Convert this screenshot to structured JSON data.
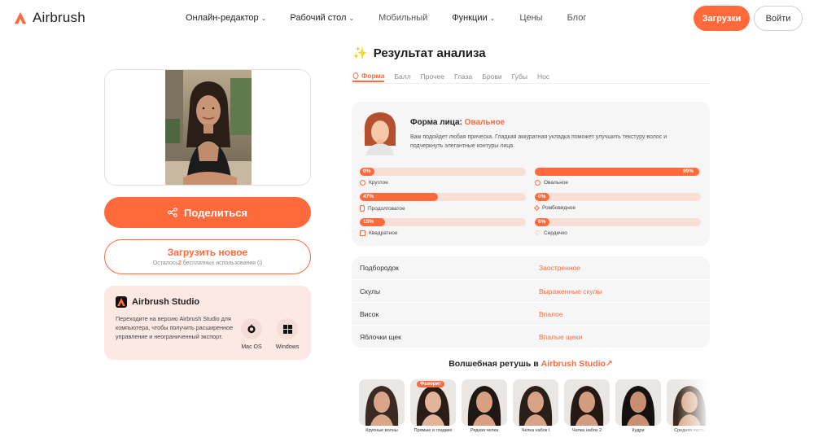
{
  "brand": {
    "name": "Airbrush",
    "accent": "#ff6a3d"
  },
  "nav": {
    "items": [
      {
        "label": "Онлайн-редактор",
        "dropdown": true
      },
      {
        "label": "Рабочий стол",
        "dropdown": true
      },
      {
        "label": "Мобильный",
        "dropdown": false
      },
      {
        "label": "Функции",
        "dropdown": true
      },
      {
        "label": "Цены",
        "dropdown": false
      },
      {
        "label": "Блог",
        "dropdown": false
      }
    ],
    "upload_label": "Загрузки",
    "login_label": "Войти"
  },
  "left": {
    "share_label": "Поделиться",
    "upload_new_label": "Загрузить новое",
    "remaining_prefix": "Осталось",
    "remaining_count": "2",
    "remaining_suffix": " бесплатных использования",
    "studio": {
      "title": "Airbrush Studio",
      "description": "Переходите на версию Airbrush Studio для компьютера, чтобы получить расширенное управление и неограниченный экспорт.",
      "os": [
        {
          "label": "Mac OS",
          "icon": "apple-icon"
        },
        {
          "label": "Windows",
          "icon": "windows-icon"
        }
      ]
    }
  },
  "result": {
    "title": "Результат анализа",
    "tabs": [
      "Форма",
      "Балл",
      "Прочее",
      "Глаза",
      "Брови",
      "Губы",
      "Нос"
    ],
    "active_tab": "Форма",
    "face_shape_label": "Форма лица:",
    "face_shape_value": "Овальное",
    "face_shape_desc": "Вам подойдет любая прическа. Гладкая аккуратная укладка поможет улучшить текстуру волос и подчеркнуть элегантные контуры лица.",
    "shapes": [
      {
        "name": "Круглое",
        "percent": 0,
        "label": "0%"
      },
      {
        "name": "Овальное",
        "percent": 99,
        "label": "99%"
      },
      {
        "name": "Продолговатое",
        "percent": 47,
        "label": "47%"
      },
      {
        "name": "Ромбовидное",
        "percent": 0,
        "label": "0%"
      },
      {
        "name": "Квадратное",
        "percent": 15,
        "label": "15%"
      },
      {
        "name": "Сердечко",
        "percent": 6,
        "label": "6%"
      }
    ],
    "features": [
      {
        "key": "Подбородок",
        "value": "Заостренное"
      },
      {
        "key": "Скулы",
        "value": "Выраженные скулы"
      },
      {
        "key": "Висок",
        "value": "Впалое"
      },
      {
        "key": "Яблочки щек",
        "value": "Впалые щеки"
      }
    ]
  },
  "magic": {
    "title_prefix": "Волшебная ретушь в ",
    "title_brand": "Airbrush Studio",
    "favorite_badge": "Фаворит",
    "styles": [
      "Крупные волны",
      "Прямые и гладкие",
      "Редкая челка",
      "Челка набок I",
      "Челка набок 2",
      "Кудри",
      "Средняя часть"
    ]
  }
}
